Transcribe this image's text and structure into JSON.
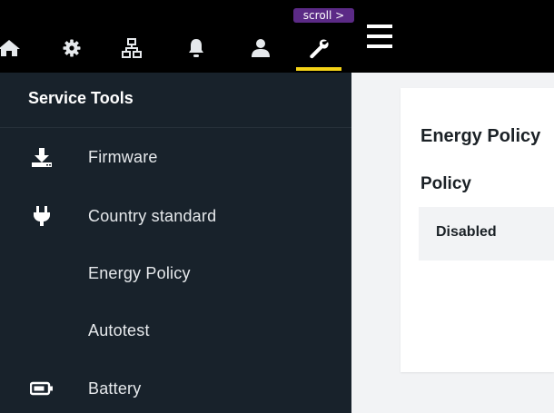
{
  "header": {
    "scroll_hint": "scroll >",
    "tabs": [
      {
        "icon": "home-icon",
        "active": false
      },
      {
        "icon": "gear-icon",
        "active": false
      },
      {
        "icon": "network-icon",
        "active": false
      },
      {
        "icon": "bell-icon",
        "active": false
      },
      {
        "icon": "user-icon",
        "active": false
      },
      {
        "icon": "wrench-icon",
        "active": true
      }
    ],
    "menu_icon": "hamburger-menu-icon",
    "accent_color": "#f5d317"
  },
  "sidebar": {
    "title": "Service Tools",
    "items": [
      {
        "label": "Firmware",
        "icon": "download-icon"
      },
      {
        "label": "Country standard",
        "icon": "plug-icon"
      },
      {
        "label": "Energy Policy",
        "icon": ""
      },
      {
        "label": "Autotest",
        "icon": ""
      },
      {
        "label": "Battery",
        "icon": "battery-icon"
      }
    ]
  },
  "main": {
    "title": "Energy Policy",
    "section_title": "Policy",
    "policy_value": "Disabled"
  }
}
